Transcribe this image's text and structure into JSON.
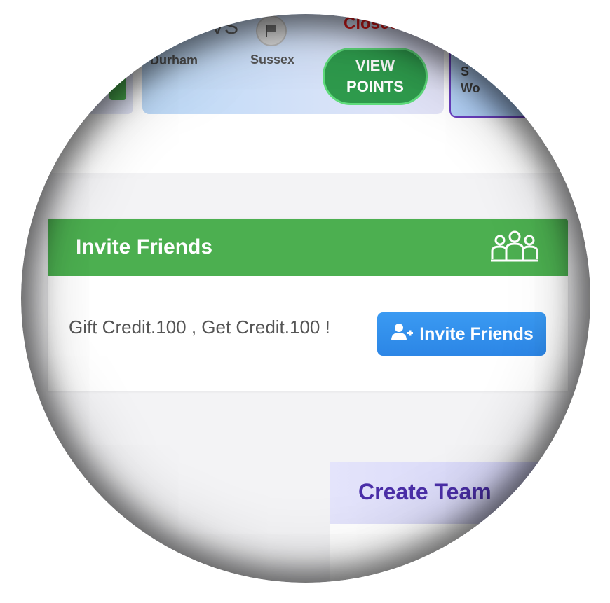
{
  "match": {
    "vs_label": "VS",
    "team_a": "Durham",
    "team_b": "Sussex",
    "status": "Closed",
    "view_points_label": "VIEW POINTS",
    "right_card_text_line1": "S",
    "right_card_text_line2": "Wo"
  },
  "invite": {
    "title": "Invite Friends",
    "icon": "group-icon",
    "message": "Gift Credit.100 , Get Credit.100 !",
    "button_label": "Invite Friends",
    "button_icon": "user-plus-icon",
    "header_color": "#4caf50",
    "button_color": "#2c86e6"
  },
  "create_team": {
    "title": "Create Team",
    "title_color": "#4b2fa8"
  },
  "colors": {
    "status_closed": "#e01b1b",
    "view_points_bg": "#2e9a4c"
  }
}
